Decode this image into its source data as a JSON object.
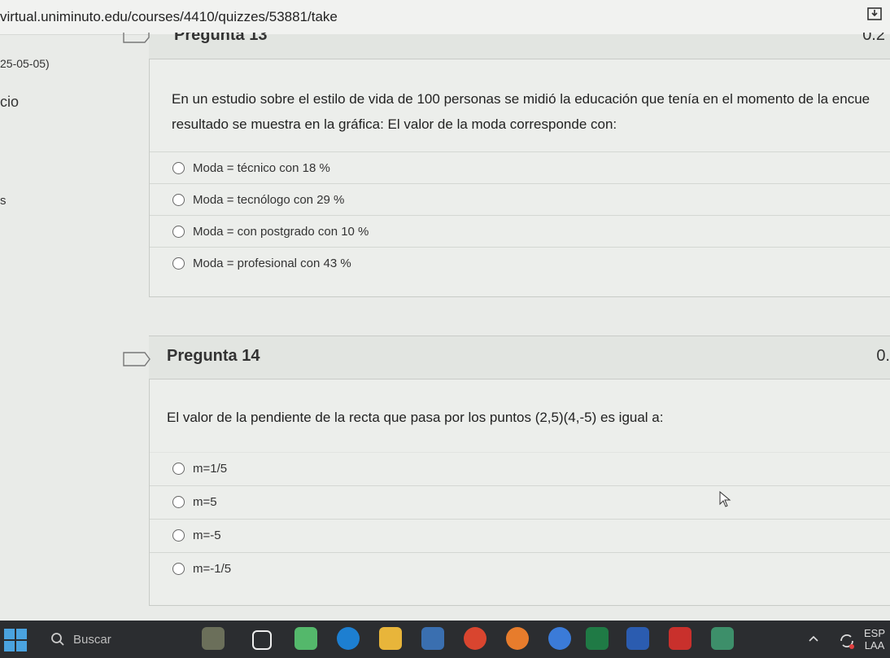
{
  "browser": {
    "url": "virtual.uniminuto.edu/courses/4410/quizzes/53881/take"
  },
  "left_panel": {
    "date_fragment": "25-05-05)",
    "word_fragment": "cio",
    "letter_fragment": "s"
  },
  "question13": {
    "title": "Pregunta 13",
    "points": "0.2",
    "text_line1": "En un estudio sobre el estilo de vida de 100 personas se midió la educación que tenía en el momento de la encue",
    "text_line2": "resultado se muestra en la gráfica: El valor de la moda corresponde con:",
    "options": [
      "Moda = técnico con 18 %",
      "Moda = tecnólogo con 29 %",
      "Moda = con postgrado con 10 %",
      "Moda = profesional con 43 %"
    ]
  },
  "question14": {
    "title": "Pregunta 14",
    "points": "0.",
    "text": "El valor de la pendiente de la recta que pasa por los puntos (2,5)(4,-5) es igual a:",
    "options": [
      "m=1/5",
      "m=5",
      "m=-5",
      "m=-1/5"
    ]
  },
  "taskbar": {
    "search_label": "Buscar",
    "lang": "ESP",
    "lang_sub": "LAA"
  }
}
